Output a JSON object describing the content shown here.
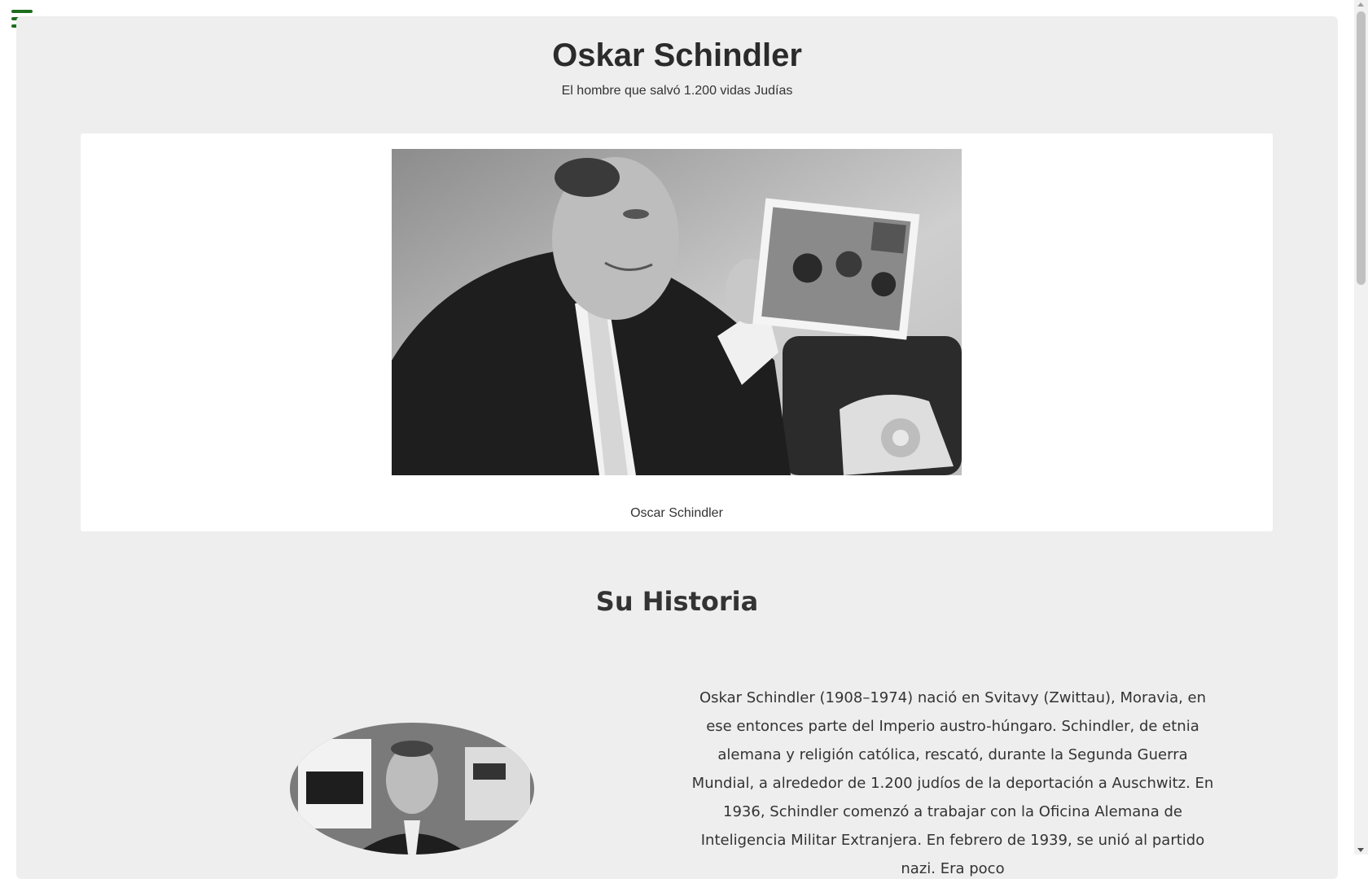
{
  "menu": {
    "icon": "hamburger-menu-icon"
  },
  "header": {
    "title": "Oskar Schindler",
    "subtitle": "El hombre que salvó 1.200 vidas Judías"
  },
  "figure": {
    "caption": "Oscar Schindler"
  },
  "history": {
    "heading": "Su Historia",
    "paragraph": "Oskar Schindler (1908–1974) nació en Svitavy (Zwittau), Moravia, en ese entonces parte del Imperio austro-húngaro. Schindler, de etnia alemana y religión católica, rescató, durante la Segunda Guerra Mundial, a alrededor de 1.200 judíos de la deportación a Auschwitz. En 1936, Schindler comenzó a trabajar con la Oficina Alemana de Inteligencia Militar Extranjera. En febrero de 1939, se unió al partido nazi. Era poco"
  }
}
